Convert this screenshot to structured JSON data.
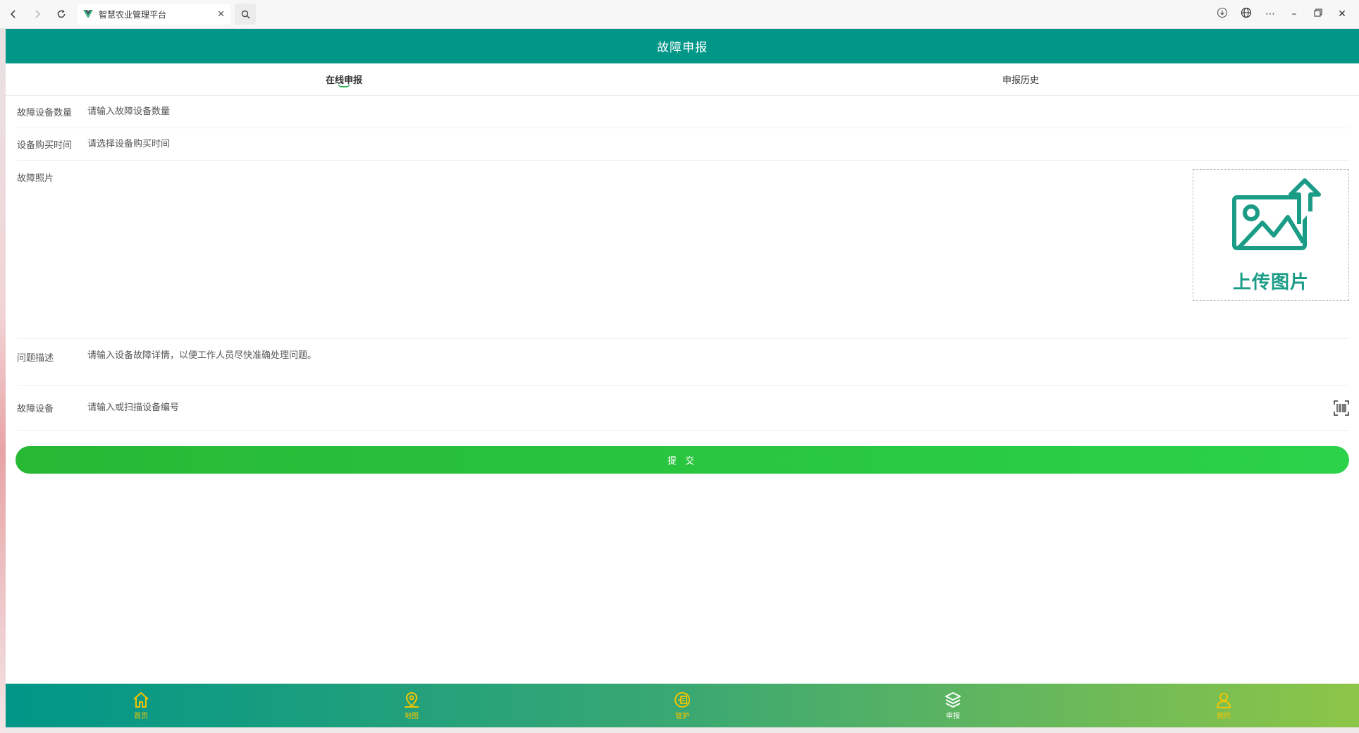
{
  "browser": {
    "tab_title": "智慧农业管理平台"
  },
  "header": {
    "title": "故障申报"
  },
  "tabs": [
    {
      "label": "在线申报",
      "active": true
    },
    {
      "label": "申报历史",
      "active": false
    }
  ],
  "form": {
    "count": {
      "label": "故障设备数量",
      "placeholder": "请输入故障设备数量"
    },
    "purchase_time": {
      "label": "设备购买时间",
      "placeholder": "请选择设备购买时间"
    },
    "photo": {
      "label": "故障照片",
      "upload_label": "上传图片"
    },
    "description": {
      "label": "问题描述",
      "placeholder": "请输入设备故障详情，以便工作人员尽快准确处理问题。"
    },
    "device": {
      "label": "故障设备",
      "placeholder": "请输入或扫描设备编号"
    }
  },
  "submit_label": "提 交",
  "bottom_nav": [
    {
      "label": "首页",
      "icon": "home-icon",
      "active": false
    },
    {
      "label": "地图",
      "icon": "map-pin-icon",
      "active": false
    },
    {
      "label": "管护",
      "icon": "maintenance-icon",
      "active": false
    },
    {
      "label": "申报",
      "icon": "layers-icon",
      "active": true
    },
    {
      "label": "我的",
      "icon": "user-icon",
      "active": false
    }
  ],
  "colors": {
    "header": "#009688",
    "accent_green": "#2bc64a",
    "nav_inactive": "#f5c400"
  }
}
